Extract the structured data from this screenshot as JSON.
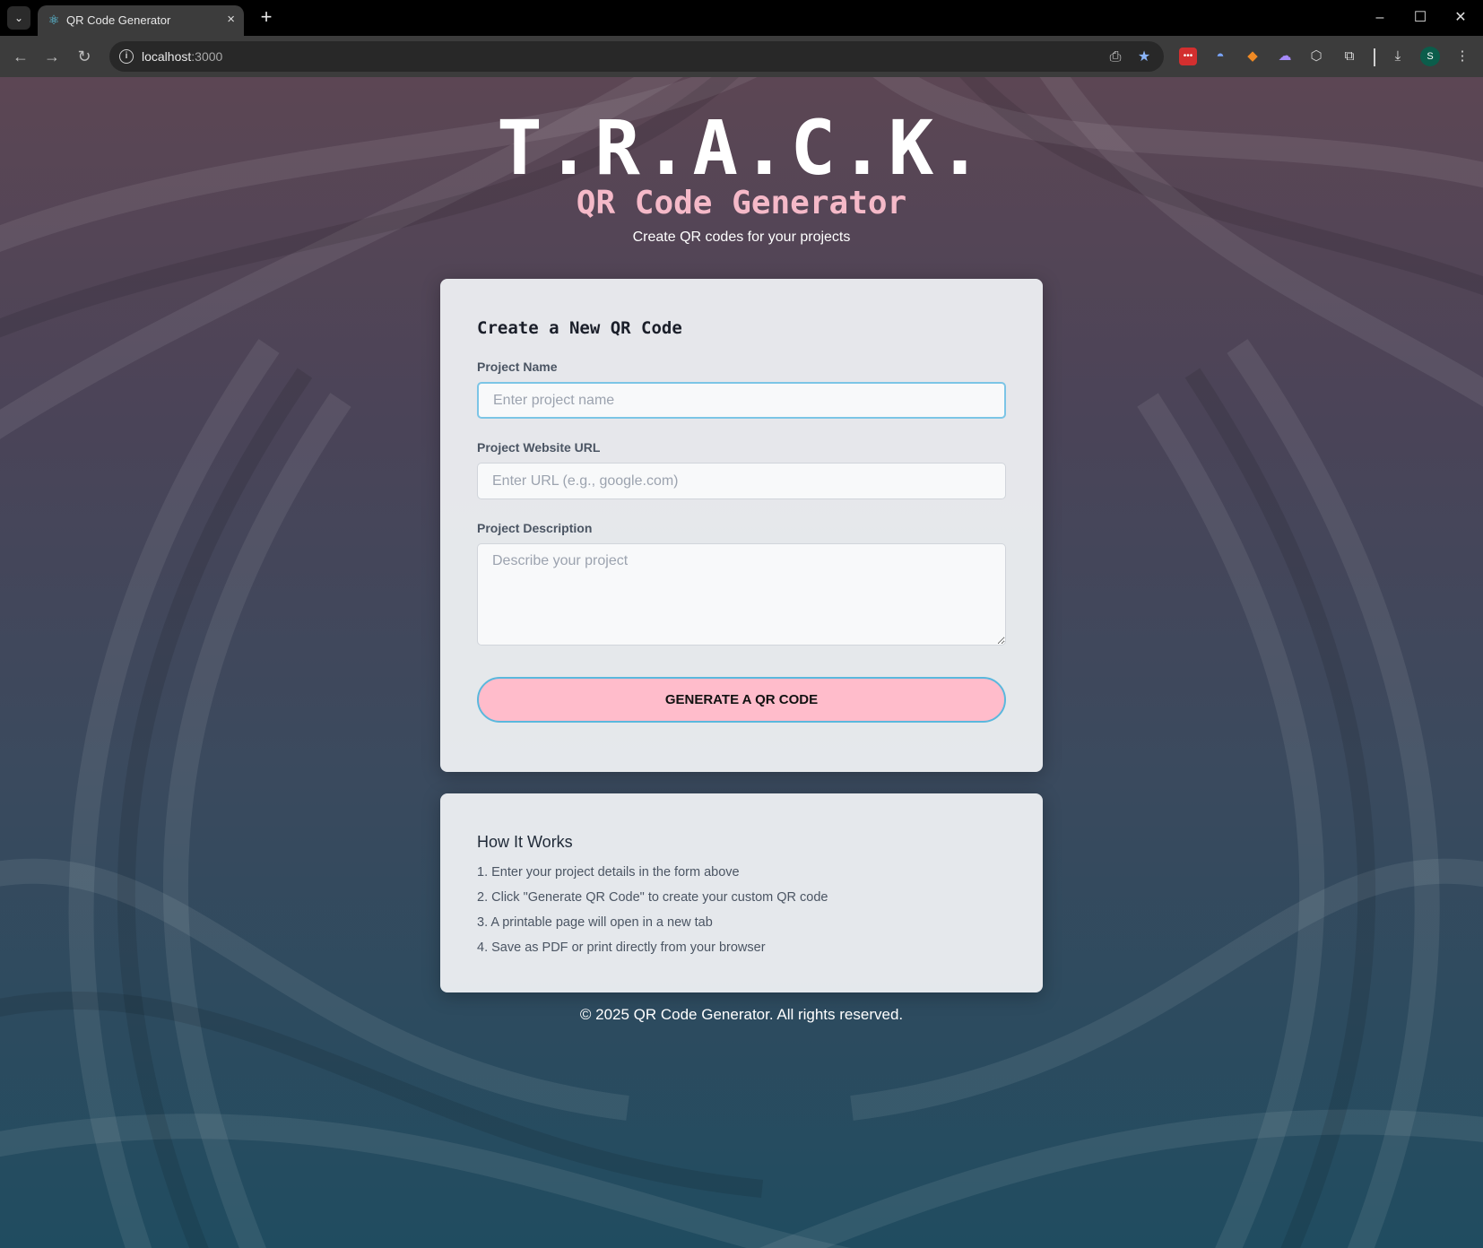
{
  "browser": {
    "tab_title": "QR Code Generator",
    "tab_close_icon": "×",
    "new_tab_icon": "+",
    "url_host": "localhost",
    "url_port": ":3000"
  },
  "hero": {
    "title": "T.R.A.C.K.",
    "subtitle": "QR Code Generator",
    "tagline": "Create QR codes for your projects"
  },
  "form": {
    "title": "Create a New QR Code",
    "project_name_label": "Project Name",
    "project_name_placeholder": "Enter project name",
    "project_name_value": "",
    "url_label": "Project Website URL",
    "url_placeholder": "Enter URL (e.g., google.com)",
    "url_value": "",
    "description_label": "Project Description",
    "description_placeholder": "Describe your project",
    "description_value": "",
    "generate_button": "GENERATE A QR CODE"
  },
  "how_it_works": {
    "title": "How It Works",
    "steps": [
      "1. Enter your project details in the form above",
      "2. Click \"Generate QR Code\" to create your custom QR code",
      "3. A printable page will open in a new tab",
      "4. Save as PDF or print directly from your browser"
    ]
  },
  "footer": {
    "copyright": "© 2025 QR Code Generator. All rights reserved."
  },
  "profile": {
    "initial": "S"
  },
  "colors": {
    "accent_pink": "#ffbccb",
    "accent_blue": "#5ab8dd",
    "subtitle_pink": "#f5b9c8",
    "card_bg": "#eceef1"
  }
}
